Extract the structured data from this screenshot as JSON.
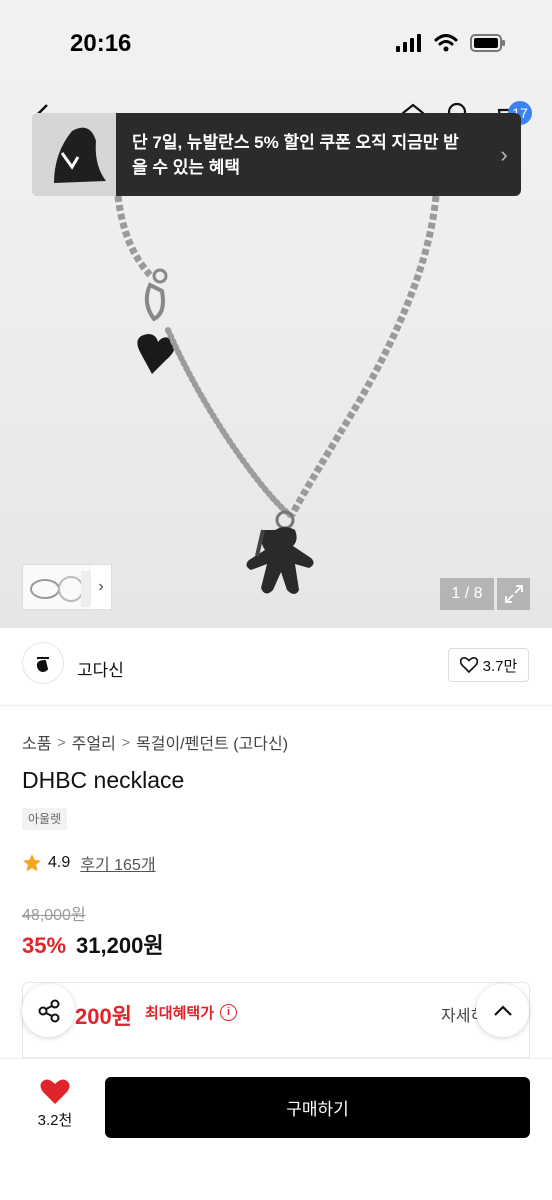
{
  "status_bar": {
    "time": "20:16"
  },
  "nav": {
    "cart_count": "17"
  },
  "promo": {
    "text": "단 7일, 뉴발란스 5% 할인 쿠폰 오직 지금만 받을 수 있는 혜택",
    "arrow": "›"
  },
  "gallery": {
    "page_counter": "1 / 8",
    "thumb_next": "›"
  },
  "brand": {
    "name": "고다신",
    "like_count": "3.7만"
  },
  "breadcrumb": [
    "소품",
    "주얼리",
    "목걸이/펜던트 (고다신)"
  ],
  "product": {
    "title": "DHBC necklace",
    "tag": "아울렛",
    "rating": "4.9",
    "reviews": "후기 165개",
    "original_price": "48,000원",
    "discount": "35%",
    "sale_price": "31,200원"
  },
  "benefit": {
    "price": "200원",
    "label": "최대혜택가",
    "detail": "자세히"
  },
  "bottom": {
    "wish_count": "3.2천",
    "buy_label": "구매하기"
  },
  "colors": {
    "accent_red": "#e0242b",
    "badge_blue": "#3b82f6",
    "buy_black": "#000000"
  },
  "icons": [
    "back-icon",
    "home-icon",
    "search-icon",
    "cart-icon",
    "fullscreen-icon",
    "heart-outline-icon",
    "star-icon",
    "info-icon",
    "share-icon",
    "chevron-up-icon",
    "heart-filled-icon",
    "signal-icon",
    "wifi-icon",
    "battery-icon"
  ]
}
